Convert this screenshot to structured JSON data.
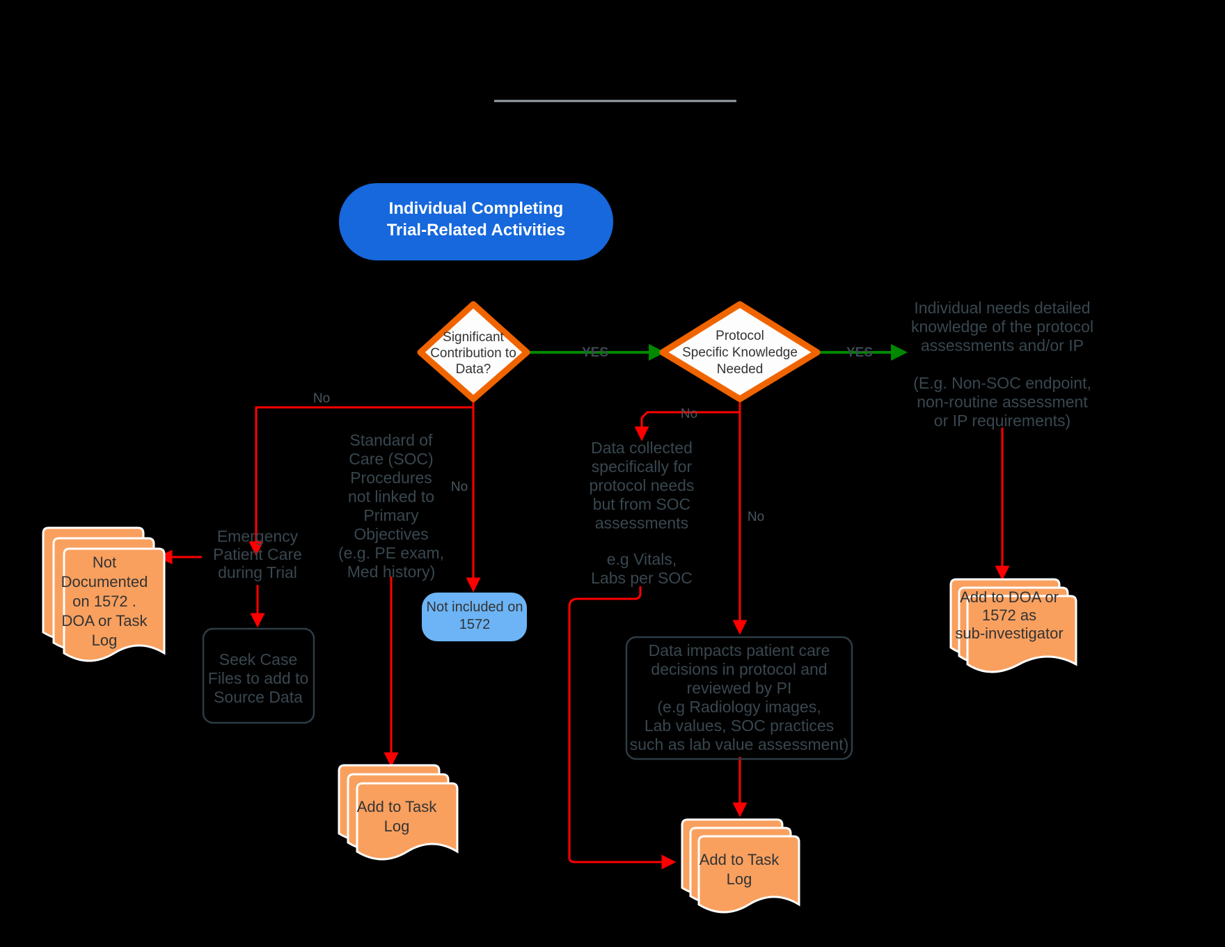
{
  "colors": {
    "background": "#000000",
    "start_fill": "#1668dc",
    "start_text": "#ffffff",
    "decision_stroke": "#f06400",
    "decision_fill": "#fdfdfd",
    "document_fill": "#f9a05f",
    "document_stroke": "#ffffff",
    "blue_box_fill": "#6cb4f5",
    "dark_box_stroke": "#2f3c44",
    "free_text": "#39474f",
    "yes_edge": "#008800",
    "no_edge": "#ff0000",
    "top_rule": "#9aa2a8"
  },
  "top_rule": {
    "name": "top-divider-line"
  },
  "nodes": {
    "start": {
      "id": "start",
      "shape": "stadium",
      "lines": [
        "Individual Completing",
        "Trial-Related Activities"
      ]
    },
    "decision_significant": {
      "id": "decision-significant-contribution",
      "shape": "diamond",
      "lines": [
        "Significant",
        "Contribution to",
        "Data?"
      ]
    },
    "decision_protocol": {
      "id": "decision-protocol-specific-knowledge",
      "shape": "diamond",
      "lines": [
        "Protocol",
        "Specific Knowledge",
        "Needed"
      ]
    },
    "doc_not_documented": {
      "id": "doc-not-documented-1572",
      "shape": "multi-document",
      "lines": [
        "Not",
        "Documented",
        "on 1572 .",
        "DOA or Task",
        "Log"
      ]
    },
    "doc_add_task_log_left": {
      "id": "doc-add-to-task-log-left",
      "shape": "multi-document",
      "lines": [
        "Add to Task",
        "Log"
      ]
    },
    "doc_add_task_log_center": {
      "id": "doc-add-to-task-log-center",
      "shape": "multi-document",
      "lines": [
        "Add to Task",
        "Log"
      ]
    },
    "doc_add_doa": {
      "id": "doc-add-to-doa-1572",
      "shape": "multi-document",
      "lines": [
        "Add to DOA or",
        "1572 as",
        "sub-investigator"
      ]
    },
    "blue_not_included": {
      "id": "box-not-included-on-1572",
      "shape": "rounded-rect-blue",
      "lines": [
        "Not included on",
        "1572"
      ]
    },
    "box_seek_case_files": {
      "id": "box-seek-case-files",
      "shape": "rounded-rect-outline",
      "lines": [
        "Seek Case",
        "Files to add to",
        "Source Data"
      ]
    },
    "box_data_impacts": {
      "id": "box-data-impacts-patient-care",
      "shape": "rounded-rect-outline",
      "lines": [
        "Data impacts patient care",
        "decisions in protocol and",
        "reviewed by PI",
        "(e.g Radiology images,",
        "Lab values, SOC practices",
        "such as lab value assessment)"
      ]
    }
  },
  "annotations": {
    "emergency_patient_care": {
      "id": "text-emergency-patient-care",
      "lines": [
        "Emergency",
        "Patient Care",
        "during Trial"
      ]
    },
    "standard_of_care": {
      "id": "text-standard-of-care-procedures",
      "lines": [
        "Standard of",
        "Care (SOC)",
        "Procedures",
        "not linked to",
        "Primary",
        "Objectives",
        "(e.g. PE exam,",
        "Med history)"
      ]
    },
    "data_collected": {
      "id": "text-data-collected-for-protocol",
      "lines": [
        "Data collected",
        "specifically for",
        "protocol needs",
        "but from SOC",
        "assessments"
      ]
    },
    "vitals_labs": {
      "id": "text-eg-vitals-labs-per-soc",
      "lines": [
        "e.g Vitals,",
        "Labs per SOC"
      ]
    },
    "individual_needs": {
      "id": "text-individual-needs-detailed-knowledge",
      "lines": [
        "Individual needs detailed",
        "knowledge of the protocol",
        "assessments and/or IP"
      ]
    },
    "individual_needs_eg": {
      "id": "text-individual-needs-examples",
      "lines": [
        "(E.g. Non-SOC endpoint,",
        "non-routine assessment",
        "or IP requirements)"
      ]
    }
  },
  "edge_labels": {
    "yes_1": "YES",
    "yes_2": "YES",
    "no_1": "No",
    "no_2": "No",
    "no_3": "No",
    "no_4": "No"
  }
}
